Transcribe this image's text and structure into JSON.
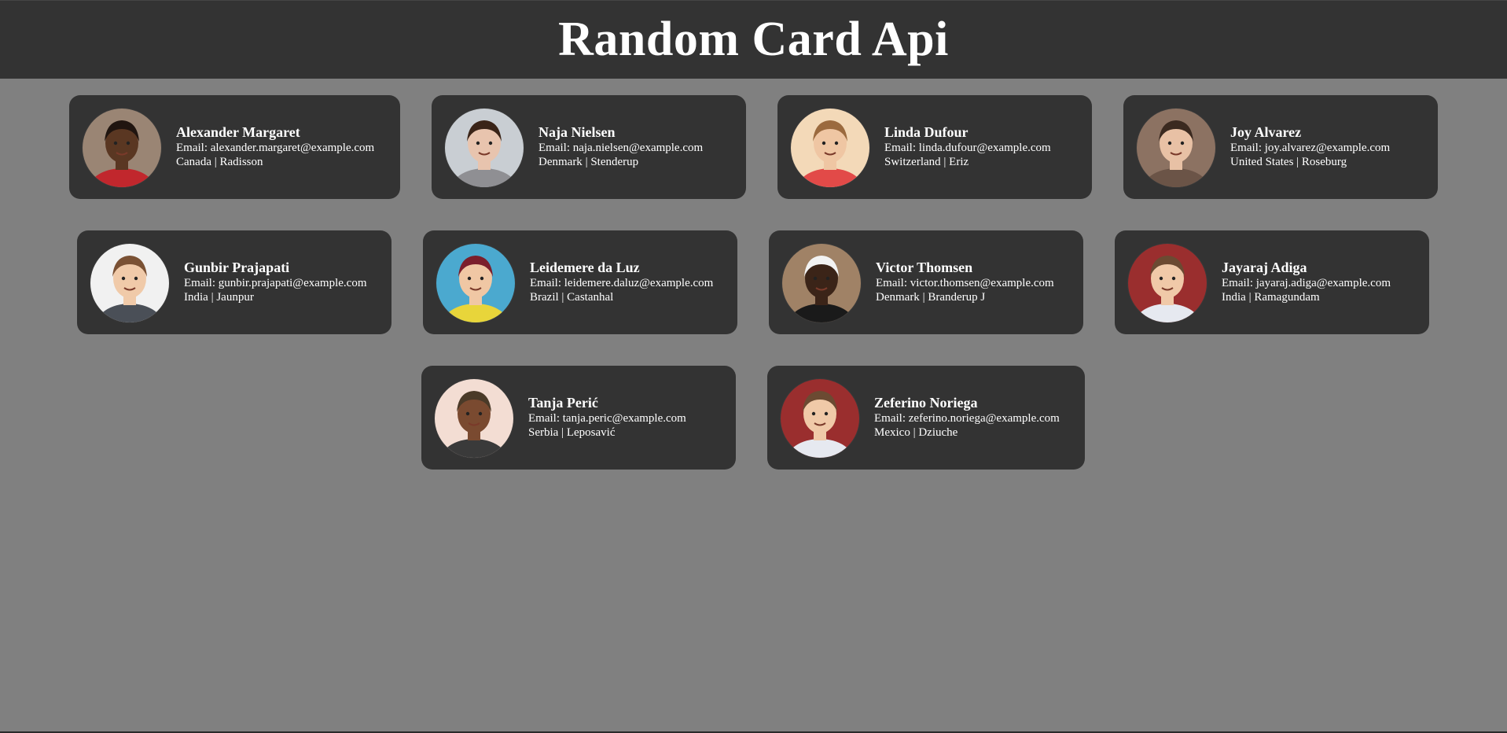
{
  "page": {
    "title": "Random Card Api",
    "colors": {
      "background": "#808080",
      "header": "#333333",
      "card": "#333333",
      "text": "#ffffff"
    }
  },
  "email_prefix": "Email: ",
  "separator": " | ",
  "cards": [
    {
      "name": "Alexander Margaret",
      "email": "alexander.margaret@example.com",
      "country": "Canada",
      "city": "Radisson",
      "avatar": {
        "bg": "#9a8574",
        "skin": "#5a3722",
        "hair": "#201510",
        "shirt": "#c1272d"
      }
    },
    {
      "name": "Naja Nielsen",
      "email": "naja.nielsen@example.com",
      "country": "Denmark",
      "city": "Stenderup",
      "avatar": {
        "bg": "#c9ced3",
        "skin": "#e8c4ae",
        "hair": "#3a2418",
        "shirt": "#8f8f93"
      }
    },
    {
      "name": "Linda Dufour",
      "email": "linda.dufour@example.com",
      "country": "Switzerland",
      "city": "Eriz",
      "avatar": {
        "bg": "#f3d9b8",
        "skin": "#efc6a3",
        "hair": "#9b6a3e",
        "shirt": "#e24a48"
      }
    },
    {
      "name": "Joy Alvarez",
      "email": "joy.alvarez@example.com",
      "country": "United States",
      "city": "Roseburg",
      "avatar": {
        "bg": "#8c7262",
        "skin": "#e8c1a5",
        "hair": "#3b2a20",
        "shirt": "#6b5447"
      }
    },
    {
      "name": "Gunbir Prajapati",
      "email": "gunbir.prajapati@example.com",
      "country": "India",
      "city": "Jaunpur",
      "avatar": {
        "bg": "#f1f1f1",
        "skin": "#f0caa9",
        "hair": "#7a5134",
        "shirt": "#4a4f57"
      }
    },
    {
      "name": "Leidemere da Luz",
      "email": "leidemere.daluz@example.com",
      "country": "Brazil",
      "city": "Castanhal",
      "avatar": {
        "bg": "#4ba9cf",
        "skin": "#f0c7a4",
        "hair": "#7b1f2c",
        "shirt": "#e8d53a"
      }
    },
    {
      "name": "Victor Thomsen",
      "email": "victor.thomsen@example.com",
      "country": "Denmark",
      "city": "Branderup J",
      "avatar": {
        "bg": "#a08266",
        "skin": "#3b2418",
        "hair": "#f2f2f2",
        "shirt": "#1a1a1a"
      }
    },
    {
      "name": "Jayaraj Adiga",
      "email": "jayaraj.adiga@example.com",
      "country": "India",
      "city": "Ramagundam",
      "avatar": {
        "bg": "#9a2e2e",
        "skin": "#f0c9a8",
        "hair": "#6b4a32",
        "shirt": "#e6e9f0"
      }
    },
    {
      "name": "Tanja Perić",
      "email": "tanja.peric@example.com",
      "country": "Serbia",
      "city": "Leposavić",
      "avatar": {
        "bg": "#f3ddd3",
        "skin": "#7a4a30",
        "hair": "#4a3a28",
        "shirt": "#3a3a3a"
      }
    },
    {
      "name": "Zeferino Noriega",
      "email": "zeferino.noriega@example.com",
      "country": "Mexico",
      "city": "Dziuche",
      "avatar": {
        "bg": "#9a2e2e",
        "skin": "#f0c9a8",
        "hair": "#6b4a32",
        "shirt": "#e6e9f0"
      }
    }
  ]
}
